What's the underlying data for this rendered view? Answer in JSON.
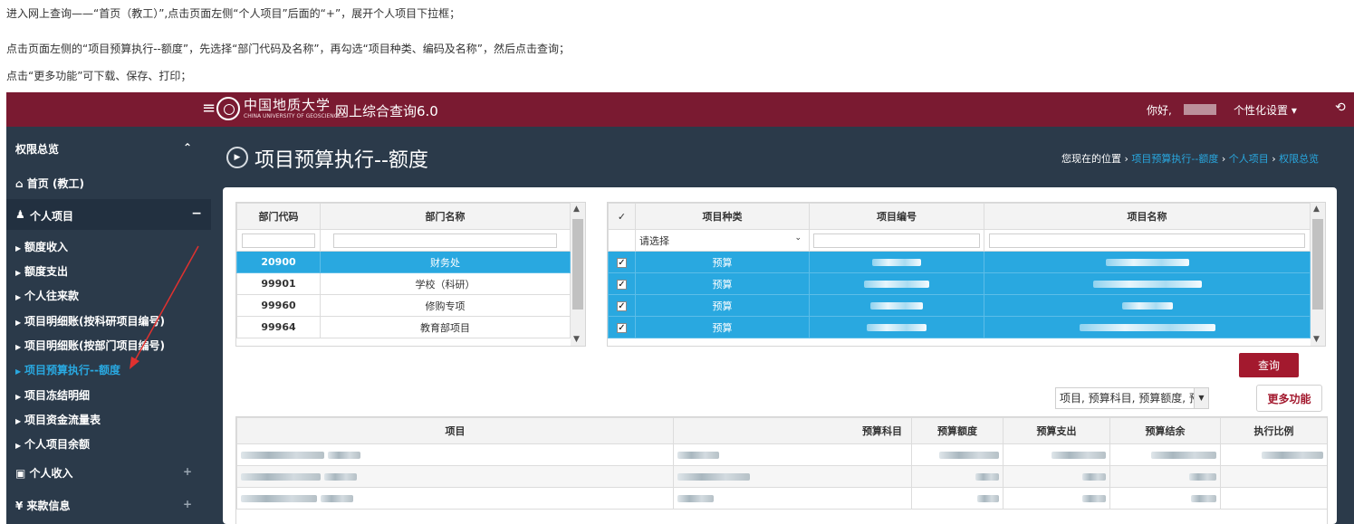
{
  "instructions": [
    "进入网上查询——“首页（教工）”,点击页面左侧“个人项目”后面的“+”，展开个人项目下拉框；",
    "点击页面左侧的“项目预算执行--额度”，先选择“部门代码及名称”，再勾选“项目种类、编码及名称”，然后点击查询；",
    "点击“更多功能”可下载、保存、打印；"
  ],
  "header": {
    "logo_text": "中国地质大学",
    "logo_subtext": "CHINA UNIVERSITY OF GEOSCIENCES",
    "app_title": "网上综合查询6.0",
    "greeting": "你好,",
    "personal_settings": "个性化设置 ▾",
    "logout_icon": "power-icon",
    "menu_icon": "hamburger-icon",
    "color": "#7a1a31"
  },
  "sidebar": {
    "overview": "权限总览",
    "home": "首页 (教工)",
    "personal_project": "个人项目",
    "sub_items": [
      "额度收入",
      "额度支出",
      "个人往来款",
      "项目明细账(按科研项目编号)",
      "项目明细账(按部门项目编号)",
      "项目预算执行--额度",
      "项目冻结明细",
      "项目资金流量表",
      "个人项目余额"
    ],
    "personal_income": "个人收入",
    "incoming_info": "来款信息",
    "active_color": "#29a8e0"
  },
  "page": {
    "title": "项目预算执行--额度",
    "breadcrumb_prefix": "您现在的位置",
    "breadcrumb": [
      "项目预算执行--额度",
      "个人项目",
      "权限总览"
    ]
  },
  "dept_grid": {
    "headers": [
      "部门代码",
      "部门名称"
    ],
    "rows": [
      {
        "code": "20900",
        "name": "财务处",
        "selected": true
      },
      {
        "code": "99901",
        "name": "学校（科研）",
        "selected": false
      },
      {
        "code": "99960",
        "name": "修购专项",
        "selected": false
      },
      {
        "code": "99964",
        "name": "教育部项目",
        "selected": false
      }
    ]
  },
  "project_grid": {
    "headers": [
      "✓",
      "项目种类",
      "项目编号",
      "项目名称"
    ],
    "filter_select": "请选择",
    "rows": [
      {
        "checked": true,
        "type": "预算"
      },
      {
        "checked": true,
        "type": "预算"
      },
      {
        "checked": true,
        "type": "预算"
      },
      {
        "checked": true,
        "type": "预算"
      }
    ]
  },
  "actions": {
    "query": "查询",
    "columns_select": "项目, 预算科目, 预算额度, 预算",
    "more": "更多功能"
  },
  "result_grid": {
    "headers": [
      "项目",
      "预算科目",
      "预算额度",
      "预算支出",
      "预算结余",
      "执行比例"
    ]
  }
}
